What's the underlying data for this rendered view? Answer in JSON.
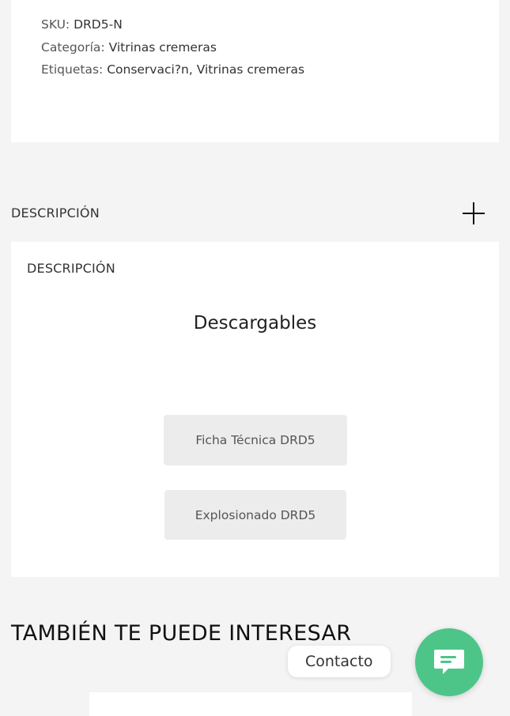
{
  "product_meta": {
    "sku_label": "SKU:",
    "sku_value": "DRD5-N",
    "category_label": "Categoría:",
    "category_value": "Vitrinas cremeras",
    "tags_label": "Etiquetas:",
    "tags_value": "Conservaci?n, Vitrinas cremeras"
  },
  "accordion": {
    "title": "DESCRIPCIÓN",
    "toggle_icon": "plus-icon"
  },
  "description": {
    "subtitle": "DESCRIPCIÓN",
    "heading": "Descargables",
    "buttons": [
      {
        "label": "Ficha Técnica DRD5"
      },
      {
        "label": "Explosionado DRD5"
      }
    ]
  },
  "related": {
    "title": "TAMBIÉN TE PUEDE INTERESAR"
  },
  "contact_widget": {
    "label": "Contacto",
    "icon": "chat-icon",
    "color": "#4dc589"
  }
}
